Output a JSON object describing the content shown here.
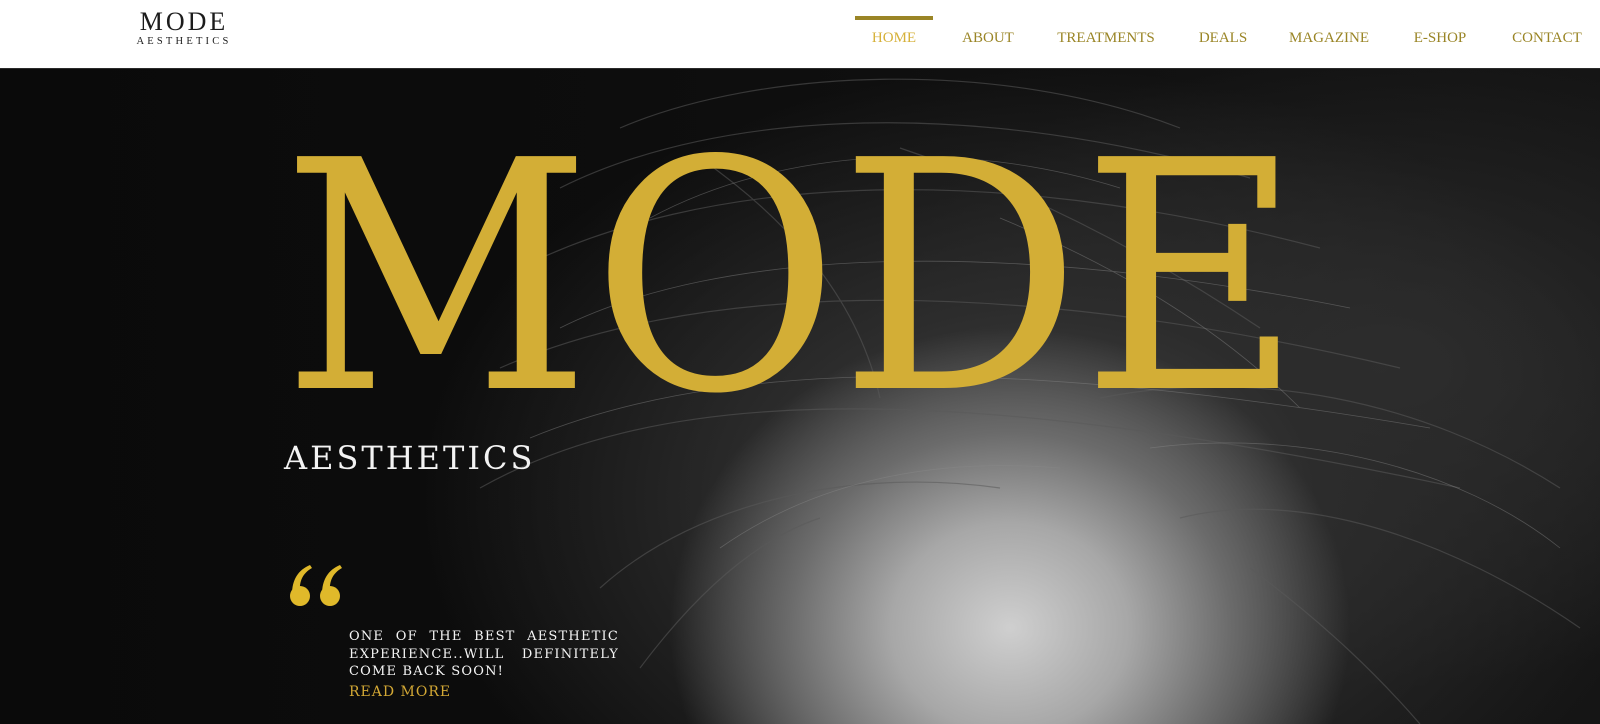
{
  "brand": {
    "name": "MODE",
    "tagline": "AESTHETICS"
  },
  "nav": {
    "items": [
      {
        "label": "HOME",
        "active": true
      },
      {
        "label": "ABOUT",
        "active": false
      },
      {
        "label": "TREATMENTS",
        "active": false
      },
      {
        "label": "DEALS",
        "active": false
      },
      {
        "label": "MAGAZINE",
        "active": false
      },
      {
        "label": "E-SHOP",
        "active": false
      },
      {
        "label": "CONTACT",
        "active": false
      }
    ]
  },
  "hero": {
    "title": "MODE",
    "subtitle": "AESTHETICS",
    "quote": "One of the best aesthetic experience..will definitely come back soon!",
    "read_more": "READ MORE",
    "quote_icon": "quote-icon"
  },
  "colors": {
    "gold": "#d6b13a",
    "nav_gold": "#9a8526",
    "header_bg": "#ffffff",
    "hero_bg": "#0b0b0b",
    "text_light": "#f5f5f5"
  }
}
